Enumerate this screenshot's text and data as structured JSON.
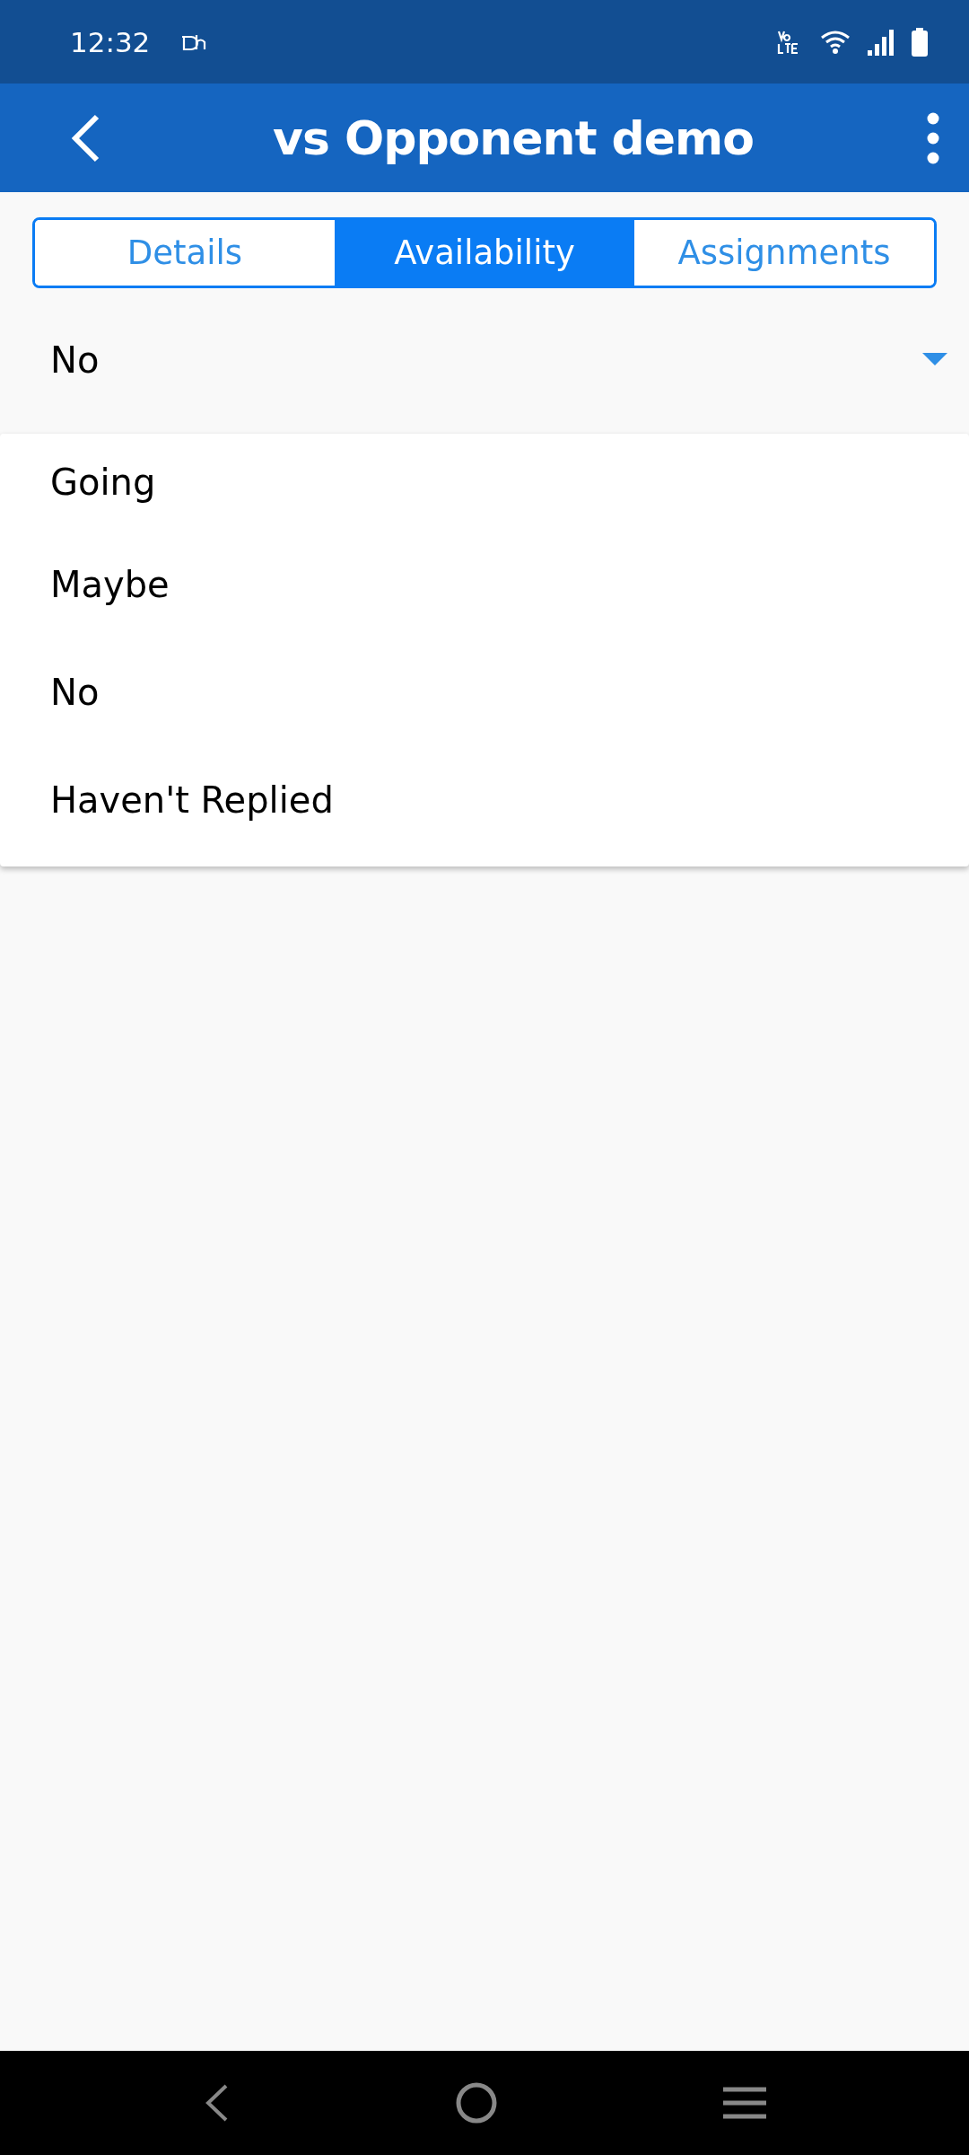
{
  "status_bar": {
    "time": "12:32"
  },
  "app_bar": {
    "title": "vs Opponent demo"
  },
  "tabs": [
    {
      "label": "Details",
      "selected": false
    },
    {
      "label": "Availability",
      "selected": true
    },
    {
      "label": "Assignments",
      "selected": false
    }
  ],
  "filter": {
    "value": "No",
    "expanded": true
  },
  "menu": {
    "items": [
      "Going",
      "Maybe",
      "No",
      "Haven't Replied"
    ]
  }
}
